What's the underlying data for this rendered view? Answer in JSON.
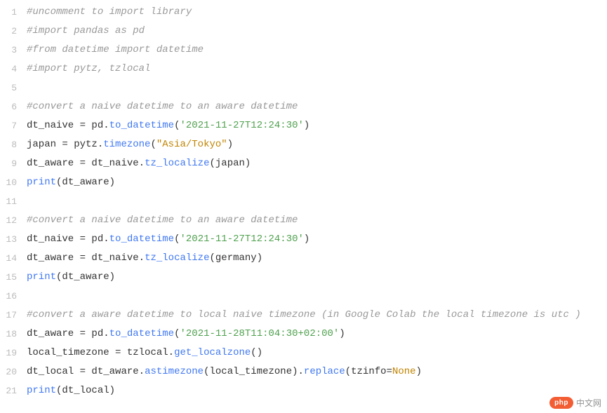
{
  "code": {
    "lines": [
      {
        "n": "1",
        "tokens": [
          {
            "t": "#uncomment to import library",
            "c": "comment"
          }
        ]
      },
      {
        "n": "2",
        "tokens": [
          {
            "t": "#import pandas as pd",
            "c": "comment"
          }
        ]
      },
      {
        "n": "3",
        "tokens": [
          {
            "t": "#from datetime import datetime",
            "c": "comment"
          }
        ]
      },
      {
        "n": "4",
        "tokens": [
          {
            "t": "#import pytz, tzlocal",
            "c": "comment"
          }
        ]
      },
      {
        "n": "5",
        "tokens": []
      },
      {
        "n": "6",
        "tokens": [
          {
            "t": "#convert a naive datetime to an aware datetime",
            "c": "comment"
          }
        ]
      },
      {
        "n": "7",
        "tokens": [
          {
            "t": "dt_naive ",
            "c": "identifier"
          },
          {
            "t": "=",
            "c": "operator"
          },
          {
            "t": " pd",
            "c": "identifier"
          },
          {
            "t": ".",
            "c": "operator"
          },
          {
            "t": "to_datetime",
            "c": "method"
          },
          {
            "t": "(",
            "c": "paren"
          },
          {
            "t": "'2021-11-27T12:24:30'",
            "c": "string"
          },
          {
            "t": ")",
            "c": "paren"
          }
        ]
      },
      {
        "n": "8",
        "tokens": [
          {
            "t": "japan ",
            "c": "identifier"
          },
          {
            "t": "=",
            "c": "operator"
          },
          {
            "t": " pytz",
            "c": "identifier"
          },
          {
            "t": ".",
            "c": "operator"
          },
          {
            "t": "timezone",
            "c": "method"
          },
          {
            "t": "(",
            "c": "paren"
          },
          {
            "t": "\"Asia/Tokyo\"",
            "c": "string2"
          },
          {
            "t": ")",
            "c": "paren"
          }
        ]
      },
      {
        "n": "9",
        "tokens": [
          {
            "t": "dt_aware ",
            "c": "identifier"
          },
          {
            "t": "=",
            "c": "operator"
          },
          {
            "t": " dt_naive",
            "c": "identifier"
          },
          {
            "t": ".",
            "c": "operator"
          },
          {
            "t": "tz_localize",
            "c": "method"
          },
          {
            "t": "(",
            "c": "paren"
          },
          {
            "t": "japan",
            "c": "identifier"
          },
          {
            "t": ")",
            "c": "paren"
          }
        ]
      },
      {
        "n": "10",
        "tokens": [
          {
            "t": "print",
            "c": "method"
          },
          {
            "t": "(",
            "c": "paren"
          },
          {
            "t": "dt_aware",
            "c": "identifier"
          },
          {
            "t": ")",
            "c": "paren"
          }
        ]
      },
      {
        "n": "11",
        "tokens": []
      },
      {
        "n": "12",
        "tokens": [
          {
            "t": "#convert a naive datetime to an aware datetime",
            "c": "comment"
          }
        ]
      },
      {
        "n": "13",
        "tokens": [
          {
            "t": "dt_naive ",
            "c": "identifier"
          },
          {
            "t": "=",
            "c": "operator"
          },
          {
            "t": " pd",
            "c": "identifier"
          },
          {
            "t": ".",
            "c": "operator"
          },
          {
            "t": "to_datetime",
            "c": "method"
          },
          {
            "t": "(",
            "c": "paren"
          },
          {
            "t": "'2021-11-27T12:24:30'",
            "c": "string"
          },
          {
            "t": ")",
            "c": "paren"
          }
        ]
      },
      {
        "n": "14",
        "tokens": [
          {
            "t": "dt_aware ",
            "c": "identifier"
          },
          {
            "t": "=",
            "c": "operator"
          },
          {
            "t": " dt_naive",
            "c": "identifier"
          },
          {
            "t": ".",
            "c": "operator"
          },
          {
            "t": "tz_localize",
            "c": "method"
          },
          {
            "t": "(",
            "c": "paren"
          },
          {
            "t": "germany",
            "c": "identifier"
          },
          {
            "t": ")",
            "c": "paren"
          }
        ]
      },
      {
        "n": "15",
        "tokens": [
          {
            "t": "print",
            "c": "method"
          },
          {
            "t": "(",
            "c": "paren"
          },
          {
            "t": "dt_aware",
            "c": "identifier"
          },
          {
            "t": ")",
            "c": "paren"
          }
        ]
      },
      {
        "n": "16",
        "tokens": []
      },
      {
        "n": "17",
        "tokens": [
          {
            "t": "#convert a aware datetime to local naive timezone (in Google Colab the local timezone is utc )",
            "c": "comment"
          }
        ]
      },
      {
        "n": "18",
        "tokens": [
          {
            "t": "dt_aware ",
            "c": "identifier"
          },
          {
            "t": "=",
            "c": "operator"
          },
          {
            "t": " pd",
            "c": "identifier"
          },
          {
            "t": ".",
            "c": "operator"
          },
          {
            "t": "to_datetime",
            "c": "method"
          },
          {
            "t": "(",
            "c": "paren"
          },
          {
            "t": "'2021-11-28T11:04:30+02:00'",
            "c": "string"
          },
          {
            "t": ")",
            "c": "paren"
          }
        ]
      },
      {
        "n": "19",
        "tokens": [
          {
            "t": "local_timezone ",
            "c": "identifier"
          },
          {
            "t": "=",
            "c": "operator"
          },
          {
            "t": " tzlocal",
            "c": "identifier"
          },
          {
            "t": ".",
            "c": "operator"
          },
          {
            "t": "get_localzone",
            "c": "method"
          },
          {
            "t": "(",
            "c": "paren"
          },
          {
            "t": ")",
            "c": "paren"
          }
        ]
      },
      {
        "n": "20",
        "tokens": [
          {
            "t": "dt_local ",
            "c": "identifier"
          },
          {
            "t": "=",
            "c": "operator"
          },
          {
            "t": " dt_aware",
            "c": "identifier"
          },
          {
            "t": ".",
            "c": "operator"
          },
          {
            "t": "astimezone",
            "c": "method"
          },
          {
            "t": "(",
            "c": "paren"
          },
          {
            "t": "local_timezone",
            "c": "identifier"
          },
          {
            "t": ")",
            "c": "paren"
          },
          {
            "t": ".",
            "c": "operator"
          },
          {
            "t": "replace",
            "c": "method"
          },
          {
            "t": "(",
            "c": "paren"
          },
          {
            "t": "tzinfo",
            "c": "identifier"
          },
          {
            "t": "=",
            "c": "operator"
          },
          {
            "t": "None",
            "c": "none"
          },
          {
            "t": ")",
            "c": "paren"
          }
        ]
      },
      {
        "n": "21",
        "tokens": [
          {
            "t": "print",
            "c": "method"
          },
          {
            "t": "(",
            "c": "paren"
          },
          {
            "t": "dt_local",
            "c": "identifier"
          },
          {
            "t": ")",
            "c": "paren"
          }
        ]
      }
    ]
  },
  "watermark": {
    "badge": "php",
    "text": "中文网"
  }
}
